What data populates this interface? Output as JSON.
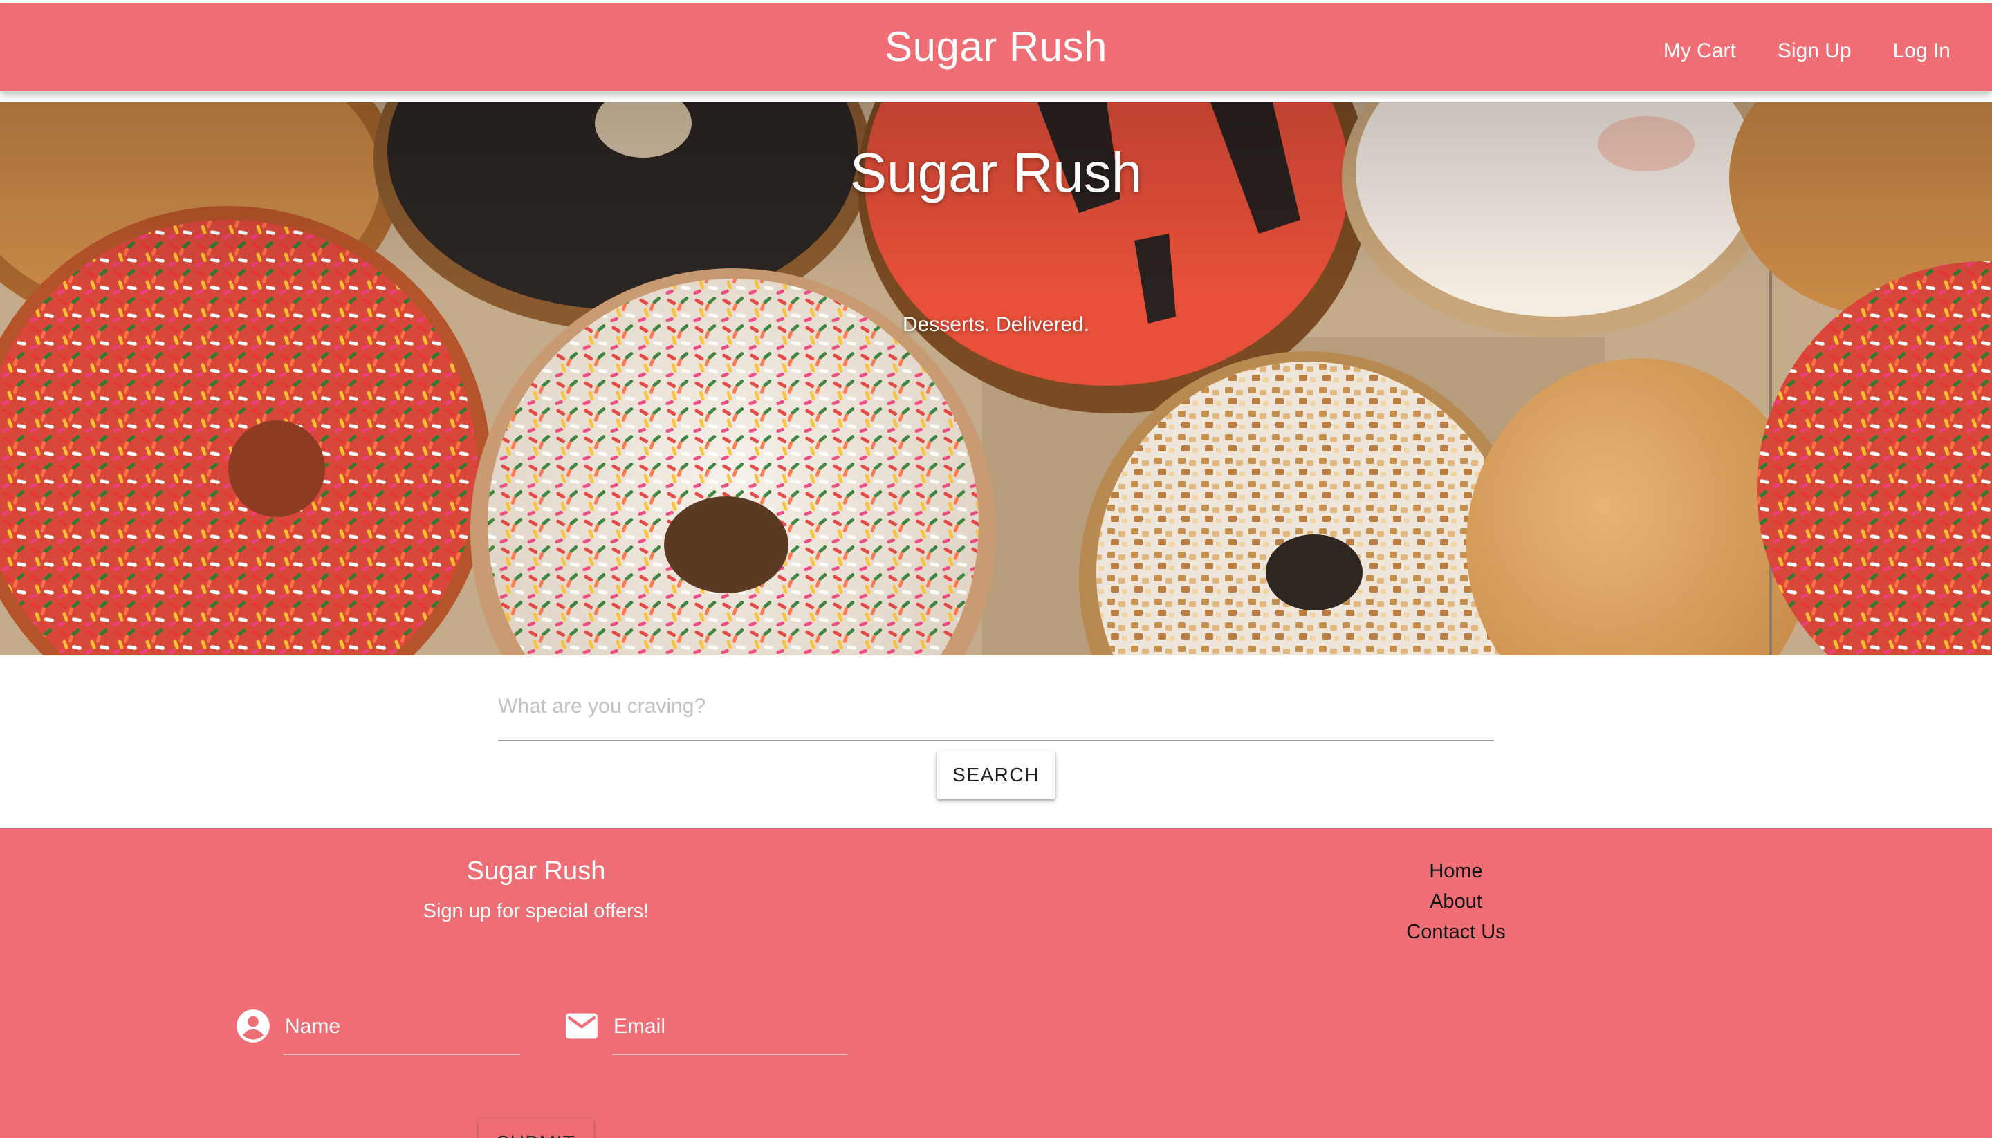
{
  "navbar": {
    "brand": "Sugar Rush",
    "links": [
      "My Cart",
      "Sign Up",
      "Log In"
    ],
    "color": "#ef6e75"
  },
  "hero": {
    "title": "Sugar Rush",
    "subtitle": "Desserts. Delivered."
  },
  "search": {
    "placeholder": "What are you craving?",
    "button_label": "SEARCH"
  },
  "footer": {
    "brand": "Sugar Rush",
    "tagline": "Sign up for special offers!",
    "links": [
      "Home",
      "About",
      "Contact Us"
    ],
    "name_placeholder": "Name",
    "email_placeholder": "Email",
    "name_icon": "account-circle-icon",
    "email_icon": "email-icon",
    "submit_label": "SUBMIT",
    "color": "#ef6e75"
  }
}
